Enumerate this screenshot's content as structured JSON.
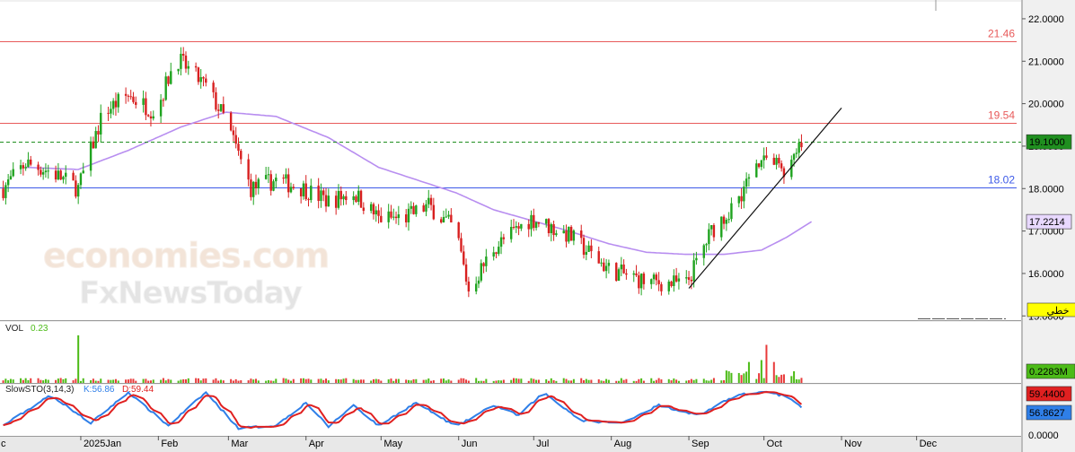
{
  "chart_data": {
    "type": "candlestick",
    "title": "",
    "price_axis": {
      "ticks": [
        "22.0000",
        "21.0000",
        "20.0000",
        "19.0000",
        "18.0000",
        "17.0000",
        "16.0000",
        "15.0000"
      ],
      "ylim": [
        14.9,
        22.4
      ]
    },
    "x_axis": {
      "labels": [
        "2025Jan",
        "Feb",
        "Mar",
        "Apr",
        "May",
        "Jun",
        "Jul",
        "Aug",
        "Sep",
        "Oct",
        "Nov",
        "Dec"
      ],
      "partial_left_label": "c"
    },
    "levels": [
      {
        "label": "21.46",
        "value": 21.46,
        "color": "#e85a5a"
      },
      {
        "label": "19.54",
        "value": 19.54,
        "color": "#e85a5a"
      },
      {
        "label": "18.02",
        "value": 18.02,
        "color": "#3d5ae8"
      }
    ],
    "current_price": {
      "label": "19.1000",
      "value": 19.1,
      "color": "#1f8f1f"
    },
    "moving_average": {
      "label": "17.2214",
      "value": 17.2214,
      "color": "#b88ef0"
    },
    "trendline": {
      "from": {
        "date": "2025-09-01",
        "value": 15.65
      },
      "to": {
        "date": "2025-11-01",
        "value": 19.9
      }
    },
    "price_anchors": [
      [
        "2024-12-01",
        18.0
      ],
      [
        "2024-12-10",
        18.6
      ],
      [
        "2024-12-20",
        18.4
      ],
      [
        "2024-12-31",
        18.0
      ],
      [
        "2025-01-10",
        19.8
      ],
      [
        "2025-01-20",
        20.2
      ],
      [
        "2025-01-31",
        19.8
      ],
      [
        "2025-02-08",
        21.1
      ],
      [
        "2025-02-20",
        20.4
      ],
      [
        "2025-02-28",
        19.6
      ],
      [
        "2025-03-10",
        18.0
      ],
      [
        "2025-03-20",
        18.2
      ],
      [
        "2025-03-31",
        18.0
      ],
      [
        "2025-04-10",
        17.7
      ],
      [
        "2025-04-20",
        17.9
      ],
      [
        "2025-04-30",
        17.3
      ],
      [
        "2025-05-10",
        17.3
      ],
      [
        "2025-05-20",
        17.6
      ],
      [
        "2025-05-31",
        17.0
      ],
      [
        "2025-06-05",
        15.6
      ],
      [
        "2025-06-15",
        16.6
      ],
      [
        "2025-06-30",
        17.3
      ],
      [
        "2025-07-15",
        16.9
      ],
      [
        "2025-07-31",
        16.1
      ],
      [
        "2025-08-15",
        15.8
      ],
      [
        "2025-08-31",
        15.75
      ],
      [
        "2025-09-10",
        17.0
      ],
      [
        "2025-09-20",
        17.7
      ],
      [
        "2025-09-30",
        18.8
      ],
      [
        "2025-10-10",
        18.4
      ],
      [
        "2025-10-16",
        19.0
      ]
    ],
    "ma_anchors": [
      [
        "2024-12-10",
        18.5
      ],
      [
        "2024-12-31",
        18.45
      ],
      [
        "2025-01-20",
        18.9
      ],
      [
        "2025-02-10",
        19.45
      ],
      [
        "2025-02-28",
        19.8
      ],
      [
        "2025-03-20",
        19.7
      ],
      [
        "2025-04-10",
        19.2
      ],
      [
        "2025-04-30",
        18.5
      ],
      [
        "2025-05-31",
        17.9
      ],
      [
        "2025-06-15",
        17.5
      ],
      [
        "2025-07-15",
        17.0
      ],
      [
        "2025-07-31",
        16.7
      ],
      [
        "2025-08-15",
        16.5
      ],
      [
        "2025-08-31",
        16.45
      ],
      [
        "2025-09-15",
        16.45
      ],
      [
        "2025-09-30",
        16.55
      ],
      [
        "2025-10-10",
        16.85
      ],
      [
        "2025-10-20",
        17.22
      ]
    ],
    "volume": {
      "label": "VOL",
      "value_label": "0.23",
      "axis_label": "0.2283M",
      "color": "#4cbb17",
      "ylim": [
        0,
        1.6
      ],
      "spikes": [
        [
          "2024-12-31",
          1.25
        ],
        [
          "2025-02-08",
          0.55
        ],
        [
          "2025-09-20",
          0.7
        ],
        [
          "2025-09-25",
          0.55
        ],
        [
          "2025-09-30",
          0.6
        ],
        [
          "2025-10-02",
          1.0
        ],
        [
          "2025-10-05",
          0.55
        ]
      ]
    },
    "stochastic": {
      "label": "SlowSTO(3,14,3)",
      "k_label": "K:56.86",
      "d_label": "D:59.44",
      "k_value": 56.8627,
      "d_value": 59.44,
      "k_axis_label": "56.8627",
      "d_axis_label": "59.4400",
      "k_color": "#2f7fe8",
      "d_color": "#e02020",
      "axis_min_label": "0.0000",
      "ylim": [
        0,
        100
      ],
      "k_anchors": [
        [
          "2024-12-01",
          20
        ],
        [
          "2024-12-20",
          80
        ],
        [
          "2025-01-05",
          25
        ],
        [
          "2025-01-20",
          85
        ],
        [
          "2025-02-05",
          20
        ],
        [
          "2025-02-20",
          85
        ],
        [
          "2025-03-05",
          15
        ],
        [
          "2025-03-20",
          20
        ],
        [
          "2025-04-01",
          65
        ],
        [
          "2025-04-10",
          18
        ],
        [
          "2025-04-20",
          60
        ],
        [
          "2025-04-30",
          20
        ],
        [
          "2025-05-15",
          65
        ],
        [
          "2025-05-31",
          18
        ],
        [
          "2025-06-15",
          60
        ],
        [
          "2025-06-25",
          40
        ],
        [
          "2025-07-05",
          85
        ],
        [
          "2025-07-20",
          30
        ],
        [
          "2025-08-05",
          25
        ],
        [
          "2025-08-20",
          60
        ],
        [
          "2025-09-05",
          40
        ],
        [
          "2025-09-20",
          80
        ],
        [
          "2025-10-01",
          85
        ],
        [
          "2025-10-10",
          78
        ],
        [
          "2025-10-16",
          57
        ]
      ]
    },
    "watermark": [
      "economies.com",
      "FxNewsToday"
    ],
    "badge": "خطي"
  }
}
